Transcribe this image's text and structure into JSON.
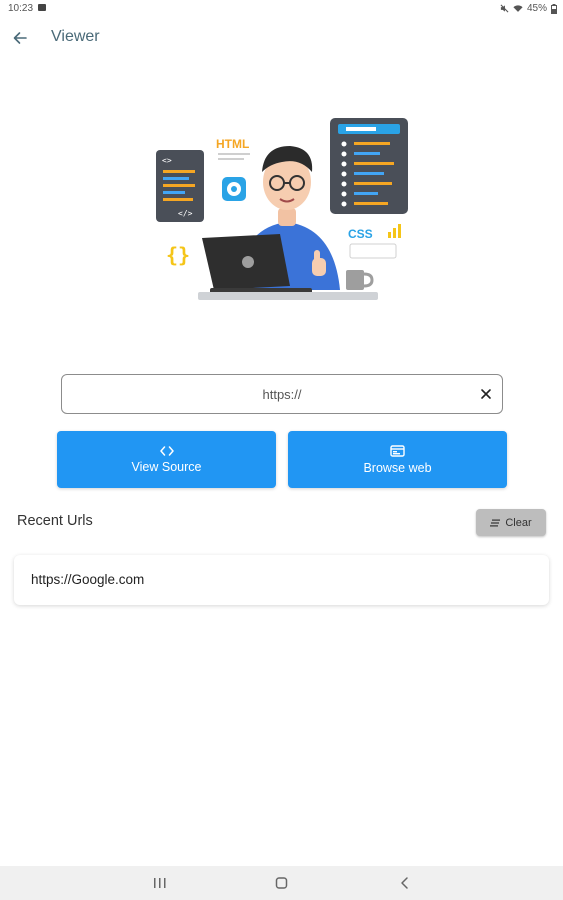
{
  "status_bar": {
    "time": "10:23",
    "battery": "45%"
  },
  "app_bar": {
    "title": "Viewer"
  },
  "url_input": {
    "placeholder": "https://",
    "value": ""
  },
  "buttons": {
    "view_source": "View Source",
    "browse_web": "Browse web"
  },
  "recent": {
    "title": "Recent Urls",
    "clear_label": "Clear",
    "items": [
      {
        "url": "https://Google.com"
      }
    ]
  },
  "colors": {
    "primary": "#2196f3",
    "title_color": "#4a6a78",
    "clear_button_bg": "#bdbdbd"
  },
  "hero_labels": {
    "html": "HTML",
    "css": "CSS"
  }
}
